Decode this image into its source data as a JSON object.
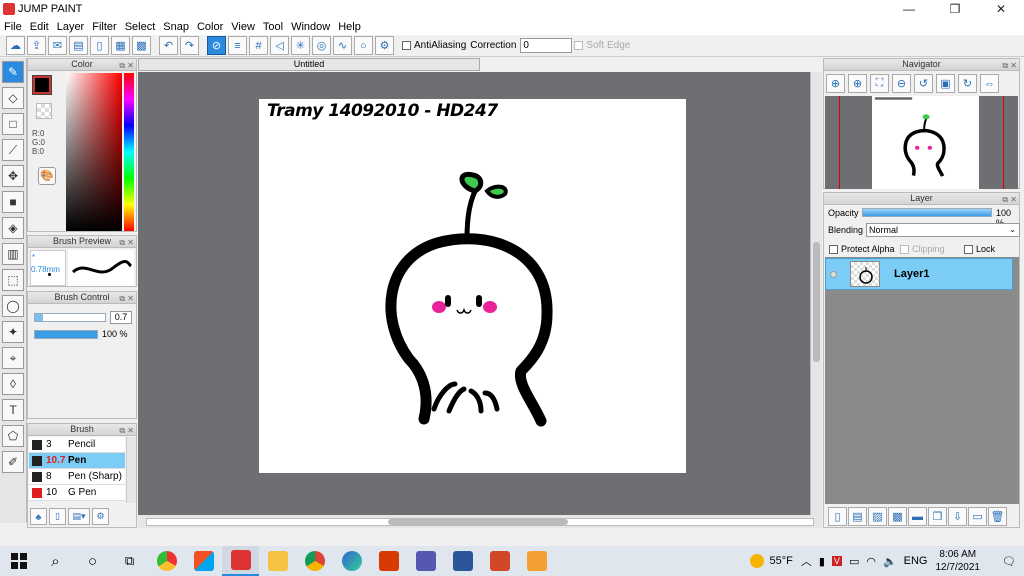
{
  "window": {
    "title": "JUMP PAINT",
    "controls": [
      "—",
      "❐",
      "✕"
    ]
  },
  "menu": [
    "File",
    "Edit",
    "Layer",
    "Filter",
    "Select",
    "Snap",
    "Color",
    "View",
    "Tool",
    "Window",
    "Help"
  ],
  "toolbar": {
    "antialiasing_label": "AntiAliasing",
    "correction_label": "Correction",
    "correction_value": "0",
    "soft_edge_label": "Soft Edge"
  },
  "color_panel": {
    "title": "Color",
    "r_label": "R:0",
    "g_label": "G:0",
    "b_label": "B:0",
    "current_color": "#000000"
  },
  "brush_preview": {
    "title": "Brush Preview",
    "size_label": "* 0.78mm"
  },
  "brush_control": {
    "title": "Brush Control",
    "size_value": "0.7",
    "opacity_value": "100 %",
    "size_fraction": 0.12,
    "opacity_fraction": 1.0
  },
  "brush_list": {
    "title": "Brush",
    "items": [
      {
        "size": "3",
        "name": "Pencil",
        "color": "#222222",
        "selected": false
      },
      {
        "size": "10.7",
        "name": "Pen",
        "color": "#222222",
        "selected": true
      },
      {
        "size": "8",
        "name": "Pen (Sharp)",
        "color": "#222222",
        "selected": false
      },
      {
        "size": "10",
        "name": "G Pen",
        "color": "#e02020",
        "selected": false
      }
    ]
  },
  "canvas": {
    "tab_title": "Untitled",
    "signature": "Tramy 14092010 - HD247"
  },
  "navigator": {
    "title": "Navigator"
  },
  "layer_panel": {
    "title": "Layer",
    "opacity_label": "Opacity",
    "opacity_value": "100 %",
    "blending_label": "Blending",
    "blending_value": "Normal",
    "protect_alpha": "Protect Alpha",
    "clipping": "Clipping",
    "lock": "Lock",
    "layers": [
      {
        "name": "Layer1"
      }
    ]
  },
  "taskbar": {
    "weather": "55°F",
    "language": "ENG",
    "time": "8:06 AM",
    "date": "12/7/2021"
  },
  "colors": {
    "accent": "#2a8ae0",
    "layer_selected": "#7ccdf6",
    "canvas_bg": "#6d6f72",
    "sprout_green": "#3ec94f",
    "blush": "#e8239a"
  }
}
